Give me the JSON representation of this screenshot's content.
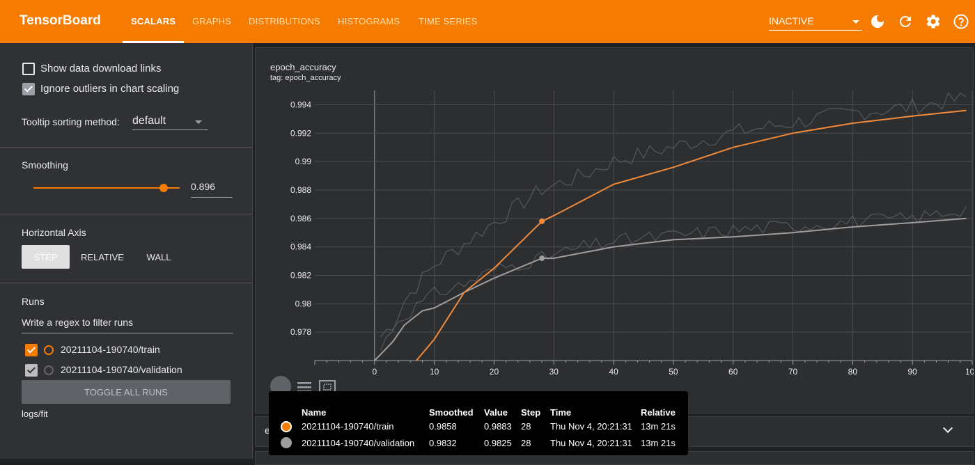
{
  "topbar": {
    "brand": "TensorBoard",
    "tabs": [
      "SCALARS",
      "GRAPHS",
      "DISTRIBUTIONS",
      "HISTOGRAMS",
      "TIME SERIES"
    ],
    "reload_status": "INACTIVE"
  },
  "sidebar": {
    "show_download_links": "Show data download links",
    "ignore_outliers": "Ignore outliers in chart scaling",
    "tooltip_sort_label": "Tooltip sorting method:",
    "tooltip_sort_value": "default",
    "smoothing_label": "Smoothing",
    "smoothing_value": "0.896",
    "smoothing_fraction": 0.896,
    "horizontal_axis_label": "Horizontal Axis",
    "axis_options": [
      "STEP",
      "RELATIVE",
      "WALL"
    ],
    "runs_label": "Runs",
    "runs_filter_placeholder": "Write a regex to filter runs",
    "runs": [
      {
        "name": "20211104-190740/train",
        "color": "#f57c00",
        "checked": true
      },
      {
        "name": "20211104-190740/validation",
        "color": "#9e9e9e",
        "checked": true
      }
    ],
    "toggle_all": "TOGGLE ALL RUNS",
    "log_dir": "logs/fit"
  },
  "card": {
    "title": "epoch_accuracy",
    "tag": "tag: epoch_accuracy",
    "collapsed_card_title": "epoch_learning_rate"
  },
  "chart_data": {
    "type": "line",
    "title": "epoch_accuracy",
    "xlim": [
      -10,
      100
    ],
    "ylim": [
      0.976,
      0.995
    ],
    "x_ticks": [
      "0",
      "10",
      "20",
      "30",
      "40",
      "50",
      "60",
      "70",
      "80",
      "90",
      "100"
    ],
    "y_ticks": [
      "0.978",
      "0.98",
      "0.982",
      "0.984",
      "0.986",
      "0.988",
      "0.99",
      "0.992",
      "0.994"
    ],
    "grid": true,
    "series": [
      {
        "name": "20211104-190740/train",
        "color": "#f57c00",
        "x": [
          7,
          10,
          15,
          20,
          28,
          30,
          40,
          50,
          60,
          70,
          80,
          90,
          99
        ],
        "y": [
          0.976,
          0.9775,
          0.9808,
          0.9825,
          0.9858,
          0.9862,
          0.9884,
          0.9896,
          0.991,
          0.992,
          0.9927,
          0.9932,
          0.9936
        ]
      },
      {
        "name": "20211104-190740/validation",
        "color": "#9e9e9e",
        "x": [
          0,
          3,
          5,
          8,
          10,
          15,
          20,
          28,
          30,
          40,
          50,
          60,
          70,
          80,
          90,
          99
        ],
        "y": [
          0.976,
          0.9773,
          0.9785,
          0.9795,
          0.9797,
          0.9808,
          0.9818,
          0.9832,
          0.9832,
          0.984,
          0.9845,
          0.9847,
          0.985,
          0.9854,
          0.9857,
          0.986
        ]
      }
    ],
    "hover_step": 28
  },
  "tooltip": {
    "headers": [
      "Name",
      "Smoothed",
      "Value",
      "Step",
      "Time",
      "Relative"
    ],
    "rows": [
      {
        "name": "20211104-190740/train",
        "smoothed": "0.9858",
        "value": "0.9883",
        "step": "28",
        "time": "Thu Nov 4, 20:21:31",
        "relative": "13m 21s",
        "color": "#f57c00"
      },
      {
        "name": "20211104-190740/validation",
        "smoothed": "0.9832",
        "value": "0.9825",
        "step": "28",
        "time": "Thu Nov 4, 20:21:31",
        "relative": "13m 21s",
        "color": "#9e9e9e"
      }
    ]
  }
}
